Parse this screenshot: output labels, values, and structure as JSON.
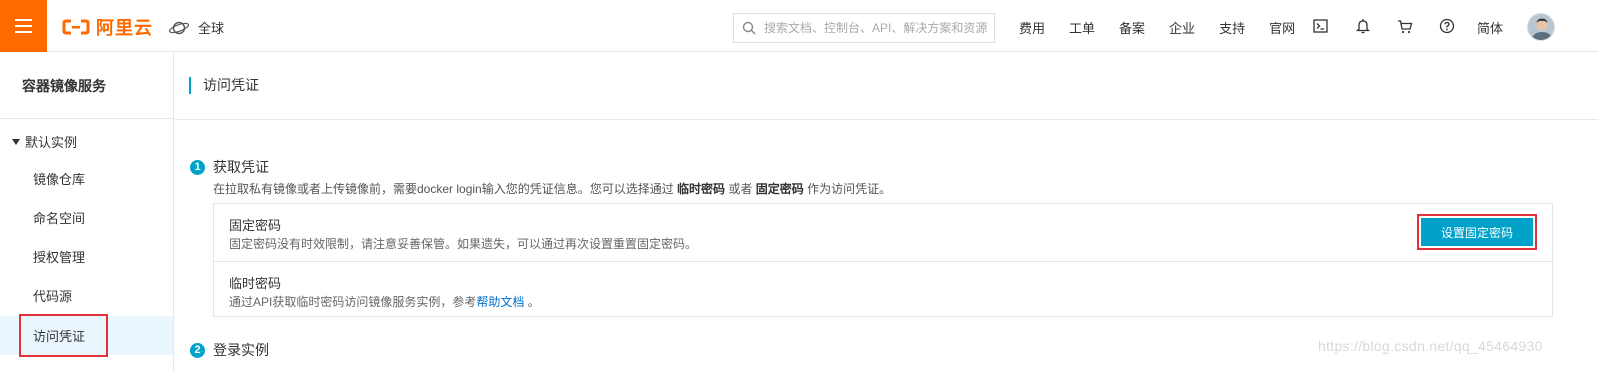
{
  "topbar": {
    "logo_text": "阿里云",
    "region": "全球",
    "search_placeholder": "搜索文档、控制台、API、解决方案和资源",
    "nav_links": [
      "费用",
      "工单",
      "备案",
      "企业",
      "支持",
      "官网"
    ],
    "lang": "简体",
    "brand_color": "#ff6a00"
  },
  "sidebar": {
    "title": "容器镜像服务",
    "group": "默认实例",
    "items": [
      "镜像仓库",
      "命名空间",
      "授权管理",
      "代码源",
      "访问凭证"
    ],
    "active": "访问凭证"
  },
  "main": {
    "title": "访问凭证",
    "step1": {
      "num": "1",
      "title": "获取凭证",
      "desc_prefix": "在拉取私有镜像或者上传镜像前，需要docker login输入您的凭证信息。您可以选择通过 ",
      "desc_bold1": "临时密码",
      "desc_mid": " 或者 ",
      "desc_bold2": "固定密码",
      "desc_suffix": " 作为访问凭证。"
    },
    "fixed": {
      "title": "固定密码",
      "desc": "固定密码没有时效限制，请注意妥善保管。如果遗失，可以通过再次设置重置固定密码。",
      "button": "设置固定密码"
    },
    "temp": {
      "title": "临时密码",
      "desc_prefix": "通过API获取临时密码访问镜像服务实例，参考",
      "link": "帮助文档",
      "desc_suffix": " 。"
    },
    "step2": {
      "num": "2",
      "title": "登录实例"
    }
  },
  "watermark": "https://blog.csdn.net/qq_45464930",
  "accent_color": "#00a2ca",
  "highlight_color": "#e1323c"
}
